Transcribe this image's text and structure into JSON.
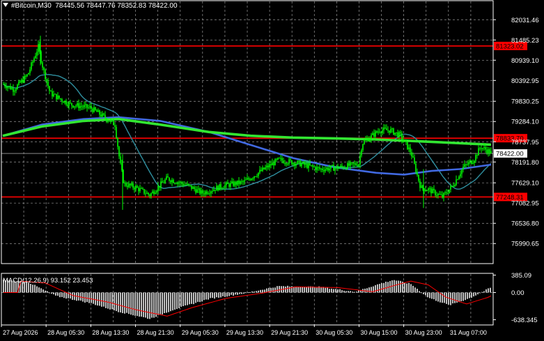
{
  "header": {
    "symbol": "#Bitcoin,M30",
    "ohlc": "78445.56 78447.76 78352.83 78422.00"
  },
  "price_axis": {
    "min": 75600,
    "max": 82300,
    "ticks": [
      "82031.46",
      "81485.23",
      "80939.10",
      "80392.95",
      "79830.25",
      "79284.10",
      "78737.95",
      "78191.80",
      "77629.10",
      "77082.95",
      "76536.80",
      "75990.65"
    ],
    "tick_values": [
      82031.46,
      81485.23,
      80939.1,
      80392.95,
      79830.25,
      79284.1,
      78737.95,
      78191.8,
      77629.1,
      77082.95,
      76536.8,
      75990.65
    ]
  },
  "levels": [
    {
      "label": "81323.02",
      "value": 81323.02,
      "color": "#ff0000"
    },
    {
      "label": "78833.70",
      "value": 78833.7,
      "color": "#ff0000"
    },
    {
      "label": "77248.31",
      "value": 77248.31,
      "color": "#ff0000"
    }
  ],
  "current_price": {
    "label": "78422.00",
    "value": 78422.0
  },
  "time_axis": [
    "27 Aug 2026",
    "28 Aug 05:30",
    "28 Aug 13:30",
    "28 Aug 21:30",
    "29 Aug 05:30",
    "29 Aug 13:30",
    "29 Aug 21:30",
    "30 Aug 05:30",
    "30 Aug 15:00",
    "30 Aug 23:00",
    "31 Aug 07:00"
  ],
  "macd": {
    "label": "MACD(12,26,9) 93.152 23.453",
    "ticks": [
      "385.09",
      "0.00",
      "-638.345"
    ],
    "tick_values": [
      385.09,
      0,
      -638.345
    ],
    "min": -700,
    "max": 420
  },
  "colors": {
    "background": "#000000",
    "grid": "#c0c0c0",
    "candles": "#00ff00",
    "ma_fast": "#2f8f9f",
    "ma_mid": "#4169e1",
    "ma_slow": "#32e632",
    "macd_hist": "#c0c0c0",
    "macd_signal": "#ff0000",
    "level": "#ff0000"
  }
}
